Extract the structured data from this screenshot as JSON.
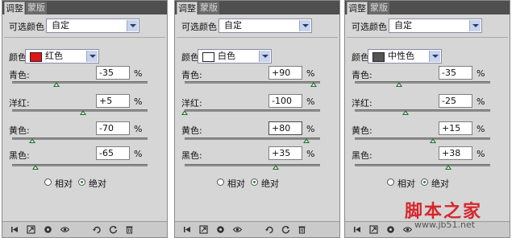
{
  "tabs": [
    "调整",
    "蒙版"
  ],
  "preset_label": "可选颜色",
  "preset_value": "自定",
  "color_label": "颜色:",
  "rows": [
    "青色:",
    "洋红:",
    "黄色:",
    "黑色:"
  ],
  "pct": "%",
  "radios": [
    "相对",
    "绝对"
  ],
  "icons": [
    "back-icon",
    "expand-icon",
    "mask-icon",
    "visibility-icon",
    "view-previous-icon",
    "reset-icon",
    "delete-icon"
  ],
  "panels": [
    {
      "color": {
        "name": "红色",
        "swatch": "#e41414"
      },
      "values": [
        "-35",
        "+5",
        "-70",
        "-65"
      ],
      "slider_levels": [
        0.325,
        0.525,
        0.15,
        0.175
      ]
    },
    {
      "color": {
        "name": "白色",
        "swatch": "#ffffff"
      },
      "values": [
        "+90",
        "-100",
        "+80",
        "+35"
      ],
      "slider_levels": [
        0.95,
        0.0,
        0.9,
        0.675
      ]
    },
    {
      "color": {
        "name": "中性色",
        "swatch": "#555555"
      },
      "values": [
        "-35",
        "-25",
        "+15",
        "+38"
      ],
      "slider_levels": [
        0.325,
        0.375,
        0.575,
        0.69
      ]
    }
  ],
  "watermark": {
    "title": "脚本之家",
    "url": "www.jb51.net"
  }
}
